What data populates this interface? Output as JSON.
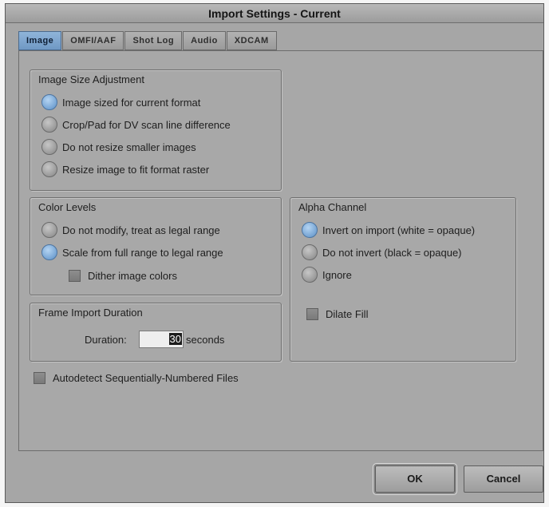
{
  "window": {
    "title": "Import Settings - Current"
  },
  "tabs": [
    {
      "label": "Image",
      "active": true
    },
    {
      "label": "OMFI/AAF",
      "active": false
    },
    {
      "label": "Shot Log",
      "active": false
    },
    {
      "label": "Audio",
      "active": false
    },
    {
      "label": "XDCAM",
      "active": false
    }
  ],
  "image_size": {
    "title": "Image Size Adjustment",
    "options": [
      {
        "label": "Image sized for current format",
        "selected": true
      },
      {
        "label": "Crop/Pad for DV scan line difference",
        "selected": false
      },
      {
        "label": "Do not resize smaller images",
        "selected": false
      },
      {
        "label": "Resize image to fit format raster",
        "selected": false
      }
    ]
  },
  "color_levels": {
    "title": "Color Levels",
    "options": [
      {
        "label": "Do not modify, treat as legal range",
        "selected": false
      },
      {
        "label": "Scale from full range to legal range",
        "selected": true
      }
    ],
    "dither_label": "Dither image colors",
    "dither_checked": false
  },
  "alpha_channel": {
    "title": "Alpha Channel",
    "options": [
      {
        "label": "Invert on import (white = opaque)",
        "selected": true
      },
      {
        "label": "Do not invert (black = opaque)",
        "selected": false
      },
      {
        "label": "Ignore",
        "selected": false
      }
    ],
    "dilate_label": "Dilate Fill",
    "dilate_checked": false
  },
  "frame_import": {
    "title": "Frame Import Duration",
    "duration_label": "Duration:",
    "duration_value": "30",
    "unit_label": "seconds"
  },
  "autodetect": {
    "label": "Autodetect Sequentially-Numbered Files",
    "checked": false
  },
  "buttons": {
    "ok": "OK",
    "cancel": "Cancel"
  },
  "colors": {
    "selected_radio": "#5b8fc6",
    "active_tab": "#7fa6cf",
    "panel_bg": "#a8a8a8"
  }
}
